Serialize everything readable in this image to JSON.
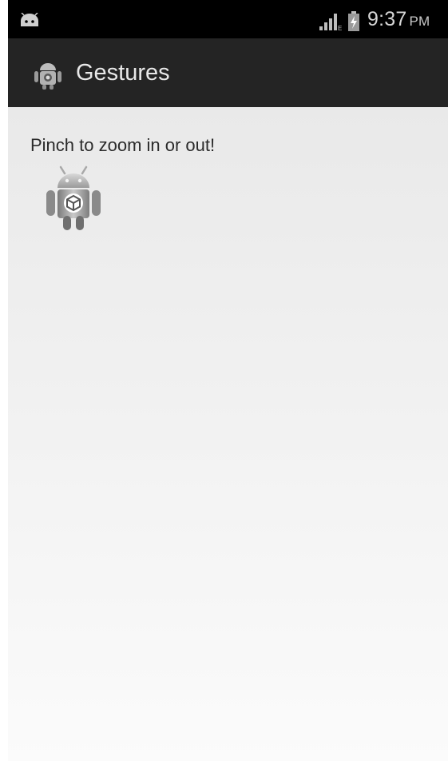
{
  "status_bar": {
    "time": "9:37",
    "ampm": "PM",
    "notification_icon": "android-notification-icon",
    "signal_icon": "signal-icon",
    "battery_icon": "battery-charging-icon"
  },
  "action_bar": {
    "title": "Gestures",
    "app_icon": "android-robot-icon"
  },
  "content": {
    "hint": "Pinch to zoom in or out!",
    "image_icon": "android-robot-icon"
  },
  "colors": {
    "status_bar_bg": "#000000",
    "action_bar_bg": "#242424",
    "content_bg_top": "#e9e9e9",
    "content_bg_bottom": "#fbfbfb"
  }
}
